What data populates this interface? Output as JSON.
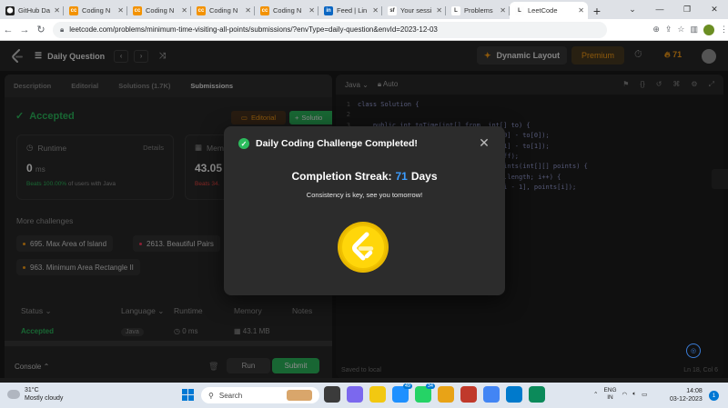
{
  "browser": {
    "tabs": [
      {
        "title": "GitHub Da",
        "fav_color": "#222222",
        "fav_glyph": "⬤"
      },
      {
        "title": "Coding N",
        "fav_color": "#f39200",
        "fav_glyph": "cc"
      },
      {
        "title": "Coding N",
        "fav_color": "#f39200",
        "fav_glyph": "cc"
      },
      {
        "title": "Coding N",
        "fav_color": "#f39200",
        "fav_glyph": "cc"
      },
      {
        "title": "Coding N",
        "fav_color": "#f39200",
        "fav_glyph": "cc"
      },
      {
        "title": "Feed | Lin",
        "fav_color": "#0a66c2",
        "fav_glyph": "in"
      },
      {
        "title": "Your sessi",
        "fav_color": "#fdfdfd",
        "fav_glyph": "sf"
      },
      {
        "title": "Problems",
        "fav_color": "#fdfdfd",
        "fav_glyph": "L"
      },
      {
        "title": "LeetCode",
        "fav_color": "#fdfdfd",
        "fav_glyph": "L",
        "active": true
      }
    ],
    "url": "leetcode.com/problems/minimum-time-visiting-all-points/submissions/?envType=daily-question&envId=2023-12-03"
  },
  "nav": {
    "problem_list": "Daily Question",
    "dynamic_layout": "Dynamic Layout",
    "premium": "Premium",
    "streak_count": "71"
  },
  "left": {
    "tabs": [
      "Description",
      "Editorial",
      "Solutions (1.7K)",
      "Submissions"
    ],
    "status": "Accepted",
    "editorial_btn": "Editorial",
    "solution_btn": "Solutio",
    "runtime": {
      "label": "Runtime",
      "details": "Details",
      "value": "0",
      "unit": "ms",
      "beats_pct": "Beats 100.00%",
      "beats_rest": "of users with Java"
    },
    "memory": {
      "label": "Memo",
      "value": "43.05",
      "beats": "Beats 34."
    },
    "more_title": "More challenges",
    "challenges": [
      {
        "label": "695. Max Area of Island",
        "color": "#ffa116"
      },
      {
        "label": "2613. Beautiful Pairs",
        "color": "#ff375f"
      },
      {
        "label": "963. Minimum Area Rectangle II",
        "color": "#ffa116"
      }
    ],
    "table_headers": [
      "Status",
      "Language",
      "Runtime",
      "Memory",
      "Notes"
    ],
    "row": {
      "status": "Accepted",
      "language": "Java",
      "runtime": "0 ms",
      "memory": "43.1 MB"
    },
    "console": "Console",
    "run": "Run",
    "submit": "Submit"
  },
  "editor": {
    "language": "Java",
    "mode": "Auto",
    "lines": [
      {
        "n": "1",
        "t": "class Solution {"
      },
      {
        "n": "2",
        "t": ""
      },
      {
        "n": "3",
        "t": "    public int toTime(int[] from, int[] to) {"
      },
      {
        "n": "",
        "t": "                                     [0] - to[0]);"
      },
      {
        "n": "",
        "t": "                                     [1] - to[1]);"
      },
      {
        "n": "",
        "t": ""
      },
      {
        "n": "",
        "t": "                                     iff);"
      },
      {
        "n": "",
        "t": ""
      },
      {
        "n": "",
        "t": ""
      },
      {
        "n": "",
        "t": "                                     oints(int[][] points) {"
      },
      {
        "n": "",
        "t": ""
      },
      {
        "n": "",
        "t": ""
      },
      {
        "n": "",
        "t": "                                     s.length; i++) {"
      },
      {
        "n": "",
        "t": "                                     [i - 1], points[i]);"
      },
      {
        "n": "",
        "t": ""
      },
      {
        "n": "",
        "t": ""
      },
      {
        "n": "",
        "t": ""
      },
      {
        "n": "",
        "t": ""
      },
      {
        "n": "",
        "t": "    }"
      }
    ],
    "saved": "Saved to local",
    "cursor": "Ln 18, Col 6"
  },
  "modal": {
    "title": "Daily Coding Challenge Completed!",
    "streak_label": "Completion Streak:",
    "streak_value": "71",
    "streak_unit": "Days",
    "tagline": "Consistency is key, see you tomorrow!",
    "accent": "#2cbb5d",
    "streak_color": "#3b9cff"
  },
  "taskbar": {
    "temp": "31°C",
    "weather": "Mostly cloudy",
    "search": "Search",
    "badges": {
      "whatsapp": "49",
      "teams": "34"
    },
    "lang": "ENG",
    "region": "IN",
    "time": "14:08",
    "date": "03-12-2023",
    "notif_count": "1"
  }
}
